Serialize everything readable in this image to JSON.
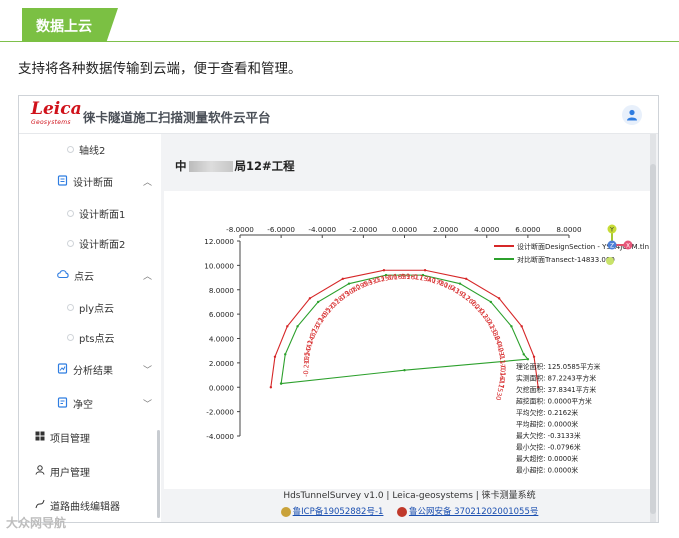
{
  "article": {
    "section_tag": "数据上云",
    "intro": "支持将各种数据传输到云端，便于查看和管理。",
    "watermark": "大众网导航"
  },
  "app": {
    "logo_word": "Leica",
    "logo_sub": "Geosystems",
    "title": "徕卡隧道施工扫描测量软件云平台"
  },
  "sidebar": {
    "items": [
      {
        "label": "轴线2"
      },
      {
        "label": "设计断面"
      },
      {
        "label": "设计断面1"
      },
      {
        "label": "设计断面2"
      },
      {
        "label": "点云"
      },
      {
        "label": "ply点云"
      },
      {
        "label": "pts点云"
      },
      {
        "label": "分析结果"
      },
      {
        "label": "净空"
      },
      {
        "label": "项目管理"
      },
      {
        "label": "用户管理"
      },
      {
        "label": "道路曲线编辑器"
      }
    ]
  },
  "main": {
    "project_title_prefix": "中",
    "project_title_suffix": "局12#工程"
  },
  "chart_data": {
    "type": "line",
    "x_ticks": [
      "-8.0000",
      "-6.0000",
      "-4.0000",
      "-2.0000",
      "0.0000",
      "2.0000",
      "4.0000",
      "6.0000",
      "8.0000"
    ],
    "x_tick_values": [
      -8,
      -6,
      -4,
      -2,
      0,
      2,
      4,
      6,
      8
    ],
    "y_ticks": [
      "12.0000",
      "10.0000",
      "8.0000",
      "6.0000",
      "4.0000",
      "2.0000",
      "0.0000",
      "-2.0000",
      "-4.0000"
    ],
    "y_tick_values": [
      12,
      10,
      8,
      6,
      4,
      2,
      0,
      -2,
      -4
    ],
    "xlim": [
      -8,
      8
    ],
    "ylim": [
      -4,
      12
    ],
    "legend_position": "top-right",
    "series": [
      {
        "name": "设计断面DesignSection - YSA",
        "color": "#d62728",
        "x": [
          -6.5,
          -6.3,
          -5.7,
          -4.6,
          -3.0,
          -1.0,
          1.0,
          3.0,
          4.6,
          5.7,
          6.3,
          6.5
        ],
        "y": [
          0.0,
          2.5,
          5.0,
          7.3,
          8.9,
          9.6,
          9.6,
          8.9,
          7.3,
          5.0,
          2.5,
          0.0
        ]
      },
      {
        "name": "对比断面Transect-14833.000",
        "color": "#2ca02c",
        "x": [
          -6.0,
          -5.8,
          -5.2,
          -4.2,
          -2.7,
          -0.9,
          0.9,
          2.7,
          4.2,
          5.2,
          5.8,
          6.0,
          0.0,
          -6.0
        ],
        "y": [
          0.3,
          2.7,
          5.0,
          7.0,
          8.5,
          9.2,
          9.2,
          8.5,
          7.0,
          5.0,
          2.7,
          2.3,
          1.4,
          0.3
        ]
      }
    ],
    "legend_extra": "4JC0M.tln",
    "data_labels_red": [
      "-0.2195",
      "-0.2441",
      "-0.2437",
      "-0.2373",
      "-0.2495",
      "-0.2737",
      "-0.2879",
      "-0.3080",
      "-0.2994",
      "-0.3133",
      "-0.2506",
      "-0.1699",
      "-0.1617",
      "-0.1540",
      "-0.1780",
      "-0.1843",
      "-0.1917",
      "-0.2000",
      "-0.2113",
      "-0.2241",
      "-0.2336",
      "-0.2440",
      "-0.2311",
      "-0.1701",
      "-0.1617",
      "-0.1530"
    ],
    "stats": [
      "理论面积: 125.0585平方米",
      "实测面积: 87.2243平方米",
      "欠挖面积: 37.8341平方米",
      "超挖面积: 0.0000平方米",
      "平均欠挖: 0.2162米",
      "平均超挖: 0.0000米",
      "最大欠挖: -0.3133米",
      "最小欠挖: -0.0796米",
      "最大超挖: 0.0000米",
      "最小超挖: 0.0000米"
    ],
    "axis_gizmo": {
      "y_label": "Y",
      "x_label": "X",
      "z_label": "Z"
    }
  },
  "footer": {
    "line": "HdsTunnelSurvey v1.0 | Leica-geosystems | 徕卡测量系统",
    "icp": "鲁ICP备19052882号-1",
    "police": "鲁公网安备 37021202001055号"
  },
  "colors": {
    "accent_green": "#7bc043",
    "leica_red": "#d0121b",
    "design_line": "#d62728",
    "transect_line": "#2ca02c"
  }
}
